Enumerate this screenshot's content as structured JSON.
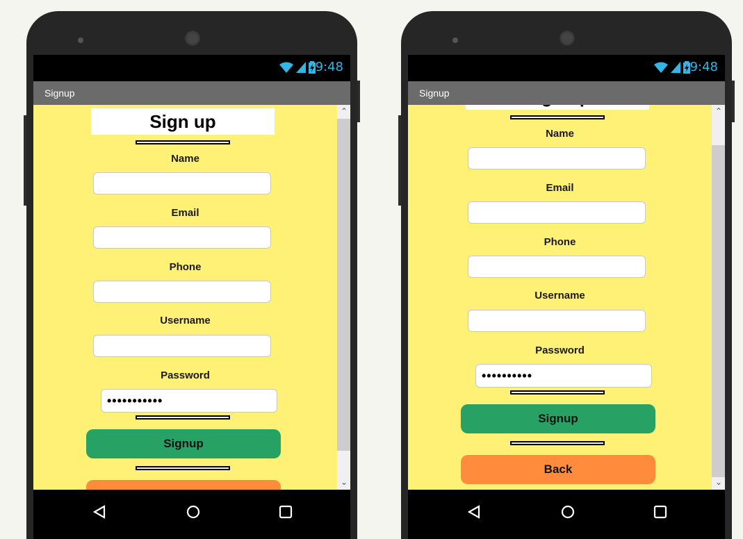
{
  "status": {
    "time": "9:48"
  },
  "screen_title": "Signup",
  "form": {
    "heading": "Sign up",
    "name_label": "Name",
    "email_label": "Email",
    "phone_label": "Phone",
    "username_label": "Username",
    "password_label": "Password",
    "password_value": "•••••••••••",
    "password_value_right": "••••••••••",
    "signup_label": "Signup",
    "back_label": "Back"
  },
  "scroll": {
    "left_position": 0.0,
    "right_position": 1.0
  },
  "colors": {
    "background": "#fff176",
    "signup": "#27a264",
    "back": "#ff8c3c",
    "titlebar": "#6b6b6b",
    "status": "#33b5e5"
  },
  "icons": [
    "wifi-icon",
    "signal-icon",
    "battery-icon",
    "back-nav-icon",
    "home-nav-icon",
    "recents-nav-icon"
  ]
}
